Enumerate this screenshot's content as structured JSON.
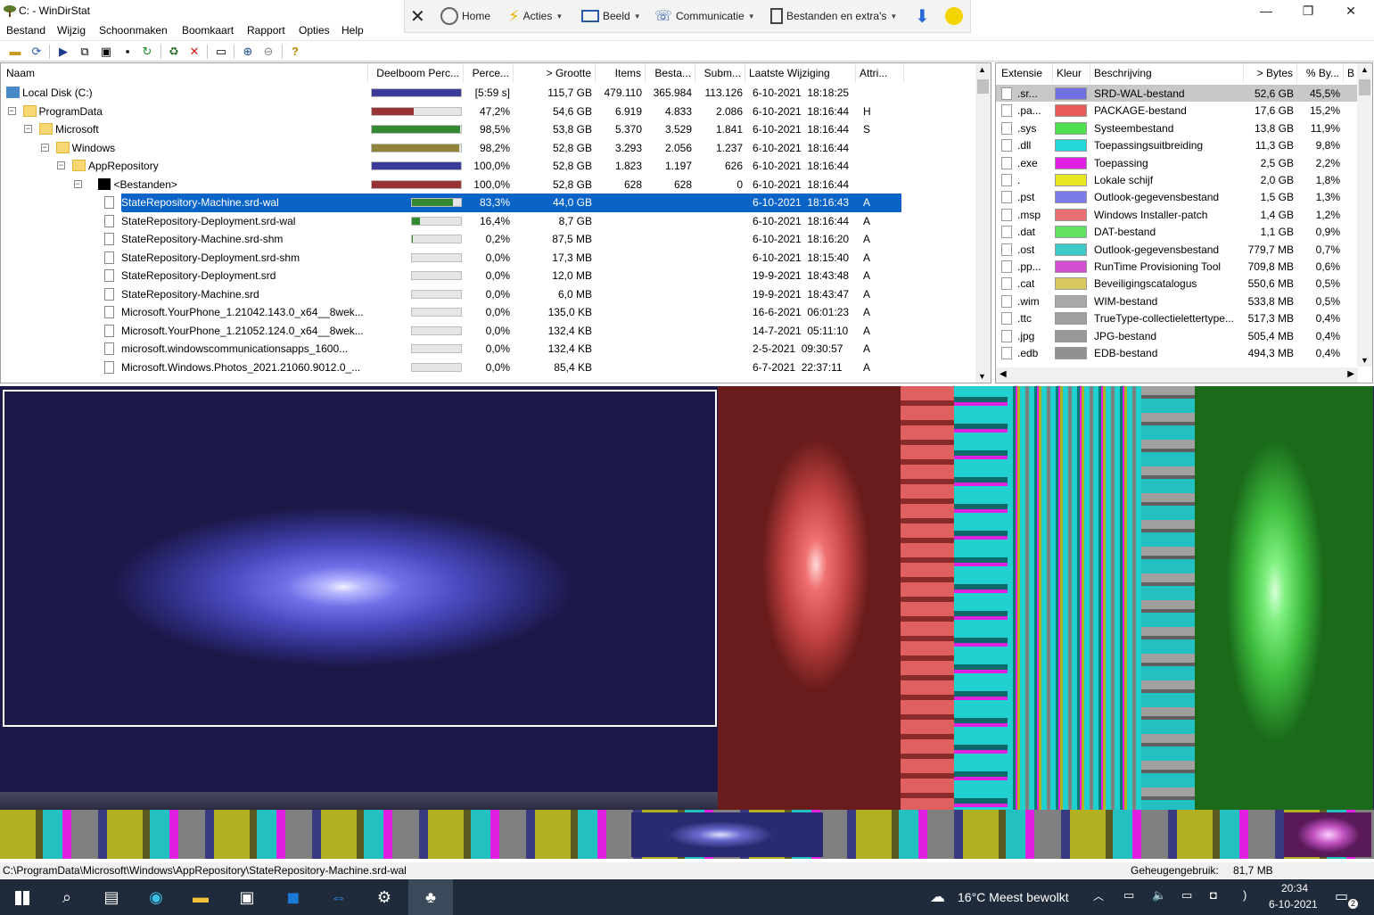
{
  "window": {
    "title": "C: - WinDirStat",
    "minimize": "—",
    "restore": "❐",
    "close": "✕"
  },
  "overlay": {
    "close": "✕",
    "home": "Home",
    "actions": "Acties",
    "view": "Beeld",
    "communication": "Communicatie",
    "files": "Bestanden en extra's"
  },
  "menu": [
    "Bestand",
    "Wijzig",
    "Schoonmaken",
    "Boomkaart",
    "Rapport",
    "Opties",
    "Help"
  ],
  "tree": {
    "headers": [
      "Naam",
      "Deelboom Perc...",
      "Perce...",
      "> Grootte",
      "Items",
      "Besta...",
      "Subm...",
      "Laatste Wijziging",
      "Attri..."
    ],
    "rows": [
      {
        "name": "Local Disk (C:)",
        "pct": "[5:59 s]",
        "size": "115,7 GB",
        "items": "479.110",
        "files": "365.984",
        "subdirs": "113.126",
        "modified": "6-10-2021  18:18:25",
        "attr": "",
        "bar": 1.0,
        "color": "#3b3b9a"
      },
      {
        "name": "ProgramData",
        "pct": "47,2%",
        "size": "54,6 GB",
        "items": "6.919",
        "files": "4.833",
        "subdirs": "2.086",
        "modified": "6-10-2021  18:16:44",
        "attr": "H",
        "bar": 0.472,
        "color": "#9a3333"
      },
      {
        "name": "Microsoft",
        "pct": "98,5%",
        "size": "53,8 GB",
        "items": "5.370",
        "files": "3.529",
        "subdirs": "1.841",
        "modified": "6-10-2021  18:16:44",
        "attr": "S",
        "bar": 0.985,
        "color": "#338a33"
      },
      {
        "name": "Windows",
        "pct": "98,2%",
        "size": "52,8 GB",
        "items": "3.293",
        "files": "2.056",
        "subdirs": "1.237",
        "modified": "6-10-2021  18:16:44",
        "attr": "",
        "bar": 0.982,
        "color": "#8f843a"
      },
      {
        "name": "AppRepository",
        "pct": "100,0%",
        "size": "52,8 GB",
        "items": "1.823",
        "files": "1.197",
        "subdirs": "626",
        "modified": "6-10-2021  18:16:44",
        "attr": "",
        "bar": 1.0,
        "color": "#3b3b9a"
      },
      {
        "name": "<Bestanden>",
        "pct": "100,0%",
        "size": "52,8 GB",
        "items": "628",
        "files": "628",
        "subdirs": "0",
        "modified": "6-10-2021  18:16:44",
        "attr": "",
        "bar": 1.0,
        "color": "#9a3333"
      },
      {
        "name": "StateRepository-Machine.srd-wal",
        "pct": "83,3%",
        "size": "44,0 GB",
        "items": "",
        "files": "",
        "subdirs": "",
        "modified": "6-10-2021  18:16:43",
        "attr": "A",
        "bar": 0.833,
        "color": "#338a33"
      },
      {
        "name": "StateRepository-Deployment.srd-wal",
        "pct": "16,4%",
        "size": "8,7 GB",
        "items": "",
        "files": "",
        "subdirs": "",
        "modified": "6-10-2021  18:16:44",
        "attr": "A",
        "bar": 0.164,
        "color": "#338a33"
      },
      {
        "name": "StateRepository-Machine.srd-shm",
        "pct": "0,2%",
        "size": "87,5 MB",
        "items": "",
        "files": "",
        "subdirs": "",
        "modified": "6-10-2021  18:16:20",
        "attr": "A",
        "bar": 0.002,
        "color": "#338a33"
      },
      {
        "name": "StateRepository-Deployment.srd-shm",
        "pct": "0,0%",
        "size": "17,3 MB",
        "items": "",
        "files": "",
        "subdirs": "",
        "modified": "6-10-2021  18:15:40",
        "attr": "A",
        "bar": 0,
        "color": "#338a33"
      },
      {
        "name": "StateRepository-Deployment.srd",
        "pct": "0,0%",
        "size": "12,0 MB",
        "items": "",
        "files": "",
        "subdirs": "",
        "modified": "19-9-2021  18:43:48",
        "attr": "A",
        "bar": 0,
        "color": "#338a33"
      },
      {
        "name": "StateRepository-Machine.srd",
        "pct": "0,0%",
        "size": "6,0 MB",
        "items": "",
        "files": "",
        "subdirs": "",
        "modified": "19-9-2021  18:43:47",
        "attr": "A",
        "bar": 0,
        "color": "#338a33"
      },
      {
        "name": "Microsoft.YourPhone_1.21042.143.0_x64__8wek...",
        "pct": "0,0%",
        "size": "135,0 KB",
        "items": "",
        "files": "",
        "subdirs": "",
        "modified": "16-6-2021  06:01:23",
        "attr": "A",
        "bar": 0,
        "color": "#338a33"
      },
      {
        "name": "Microsoft.YourPhone_1.21052.124.0_x64__8wek...",
        "pct": "0,0%",
        "size": "132,4 KB",
        "items": "",
        "files": "",
        "subdirs": "",
        "modified": "14-7-2021  05:11:10",
        "attr": "A",
        "bar": 0,
        "color": "#338a33"
      },
      {
        "name": "microsoft.windowscommunicationsapps_1600...",
        "pct": "0,0%",
        "size": "132,4 KB",
        "items": "",
        "files": "",
        "subdirs": "",
        "modified": "2-5-2021  09:30:57",
        "attr": "A",
        "bar": 0,
        "color": "#338a33"
      },
      {
        "name": "Microsoft.Windows.Photos_2021.21060.9012.0_...",
        "pct": "0,0%",
        "size": "85,4 KB",
        "items": "",
        "files": "",
        "subdirs": "",
        "modified": "6-7-2021  22:37:11",
        "attr": "A",
        "bar": 0,
        "color": "#338a33"
      }
    ]
  },
  "extensions": {
    "headers": [
      "Extensie",
      "Kleur",
      "Beschrijving",
      "> Bytes",
      "% By...",
      "B"
    ],
    "rows": [
      {
        "ext": ".sr...",
        "color": "#7070e0",
        "desc": "SRD-WAL-bestand",
        "bytes": "52,6 GB",
        "pct": "45,5%"
      },
      {
        "ext": ".pa...",
        "color": "#e85a5a",
        "desc": "PACKAGE-bestand",
        "bytes": "17,6 GB",
        "pct": "15,2%"
      },
      {
        "ext": ".sys",
        "color": "#4fe04f",
        "desc": "Systeembestand",
        "bytes": "13,8 GB",
        "pct": "11,9%"
      },
      {
        "ext": ".dll",
        "color": "#22d8d8",
        "desc": "Toepassingsuitbreiding",
        "bytes": "11,3 GB",
        "pct": "9,8%"
      },
      {
        "ext": ".exe",
        "color": "#e020e0",
        "desc": "Toepassing",
        "bytes": "2,5 GB",
        "pct": "2,2%"
      },
      {
        "ext": ".",
        "color": "#e8e820",
        "desc": "Lokale schijf",
        "bytes": "2,0 GB",
        "pct": "1,8%"
      },
      {
        "ext": ".pst",
        "color": "#7a7ae8",
        "desc": "Outlook-gegevensbestand",
        "bytes": "1,5 GB",
        "pct": "1,3%"
      },
      {
        "ext": ".msp",
        "color": "#e87070",
        "desc": "Windows Installer-patch",
        "bytes": "1,4 GB",
        "pct": "1,2%"
      },
      {
        "ext": ".dat",
        "color": "#62e062",
        "desc": "DAT-bestand",
        "bytes": "1,1 GB",
        "pct": "0,9%"
      },
      {
        "ext": ".ost",
        "color": "#40c8c8",
        "desc": "Outlook-gegevensbestand",
        "bytes": "779,7 MB",
        "pct": "0,7%"
      },
      {
        "ext": ".pp...",
        "color": "#d050d0",
        "desc": "RunTime Provisioning Tool",
        "bytes": "709,8 MB",
        "pct": "0,6%"
      },
      {
        "ext": ".cat",
        "color": "#d8c860",
        "desc": "Beveiligingscatalogus",
        "bytes": "550,6 MB",
        "pct": "0,5%"
      },
      {
        "ext": ".wim",
        "color": "#a8a8a8",
        "desc": "WIM-bestand",
        "bytes": "533,8 MB",
        "pct": "0,5%"
      },
      {
        "ext": ".ttc",
        "color": "#a0a0a0",
        "desc": "TrueType-collectielettertype...",
        "bytes": "517,3 MB",
        "pct": "0,4%"
      },
      {
        "ext": ".jpg",
        "color": "#989898",
        "desc": "JPG-bestand",
        "bytes": "505,4 MB",
        "pct": "0,4%"
      },
      {
        "ext": ".edb",
        "color": "#909090",
        "desc": "EDB-bestand",
        "bytes": "494,3 MB",
        "pct": "0,4%"
      }
    ]
  },
  "status": {
    "path": "C:\\ProgramData\\Microsoft\\Windows\\AppRepository\\StateRepository-Machine.srd-wal",
    "memory_label": "Geheugengebruik:",
    "memory_value": "81,7 MB"
  },
  "taskbar": {
    "weather": "16°C  Meest bewolkt",
    "time": "20:34",
    "date": "6-10-2021",
    "notifications": "2"
  }
}
